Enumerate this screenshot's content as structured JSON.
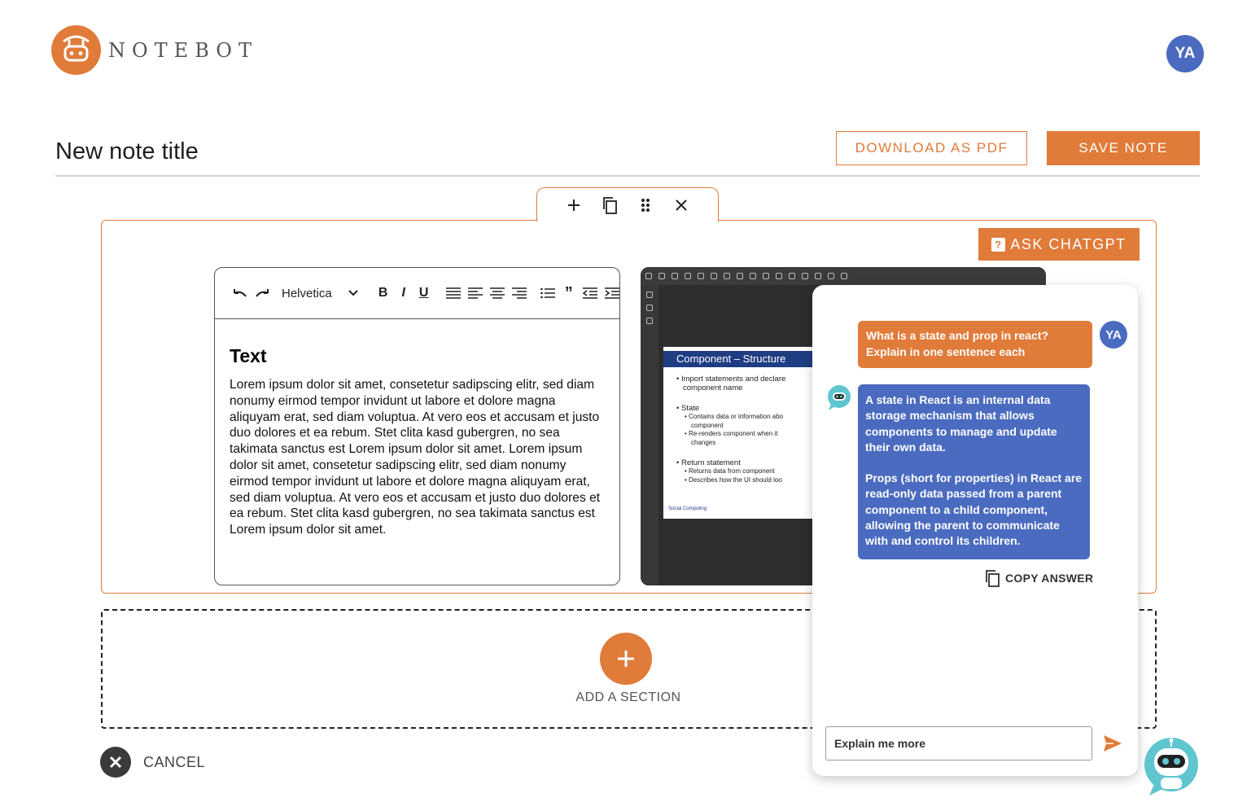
{
  "header": {
    "brand": "NOTEBOT",
    "user_initials": "YA"
  },
  "note": {
    "title": "New note title",
    "download_label": "DOWNLOAD AS PDF",
    "save_label": "SAVE NOTE"
  },
  "section_toolbar": {
    "icons": [
      "plus-icon",
      "copy-icon",
      "drag-handle-icon",
      "close-icon"
    ]
  },
  "ask_chatgpt": {
    "label": "ASK CHATGPT"
  },
  "editor": {
    "font": "Helvetica",
    "heading": "Text",
    "body": "Lorem ipsum dolor sit amet, consetetur sadipscing elitr, sed diam nonumy eirmod tempor invidunt ut labore et dolore magna aliquyam erat, sed diam voluptua. At vero eos et accusam et justo duo dolores et ea rebum. Stet clita kasd gubergren, no sea takimata sanctus est Lorem ipsum dolor sit amet. Lorem ipsum dolor sit amet, consetetur sadipscing elitr, sed diam nonumy eirmod tempor invidunt ut labore et dolore magna aliquyam erat, sed diam voluptua. At vero eos et accusam et justo duo dolores et ea rebum. Stet clita kasd gubergren, no sea takimata sanctus est Lorem ipsum dolor sit amet."
  },
  "pdf": {
    "slide_title": "Component – Structure",
    "bullet_1": "• Import statements and declare",
    "bullet_1b": "component name",
    "bullet_2": "• State",
    "bullet_2a": "• Contains data or information abo",
    "bullet_2a2": "component",
    "bullet_2b": "• Re-renders component when it",
    "bullet_2b2": "changes",
    "bullet_3": "• Return statement",
    "bullet_3a": "• Returns data from component",
    "bullet_3b": "• Describes how the UI should loo",
    "logo_text": "Social Computing"
  },
  "add_section": {
    "label": "ADD A SECTION"
  },
  "cancel": {
    "label": "CANCEL"
  },
  "chat": {
    "user_initials": "YA",
    "question": "What is a state and prop in react? Explain in one sentence each",
    "answer_p1": "A state in React is an internal data storage mechanism that allows components to manage and update their own data.",
    "answer_p2": "Props (short for properties) in React are read-only data passed from a parent component to a child component, allowing the parent to communicate with and control its children.",
    "copy_label": "COPY ANSWER",
    "input_value": "Explain me more"
  },
  "colors": {
    "accent": "#e07b39",
    "blue": "#4a6bbf"
  }
}
